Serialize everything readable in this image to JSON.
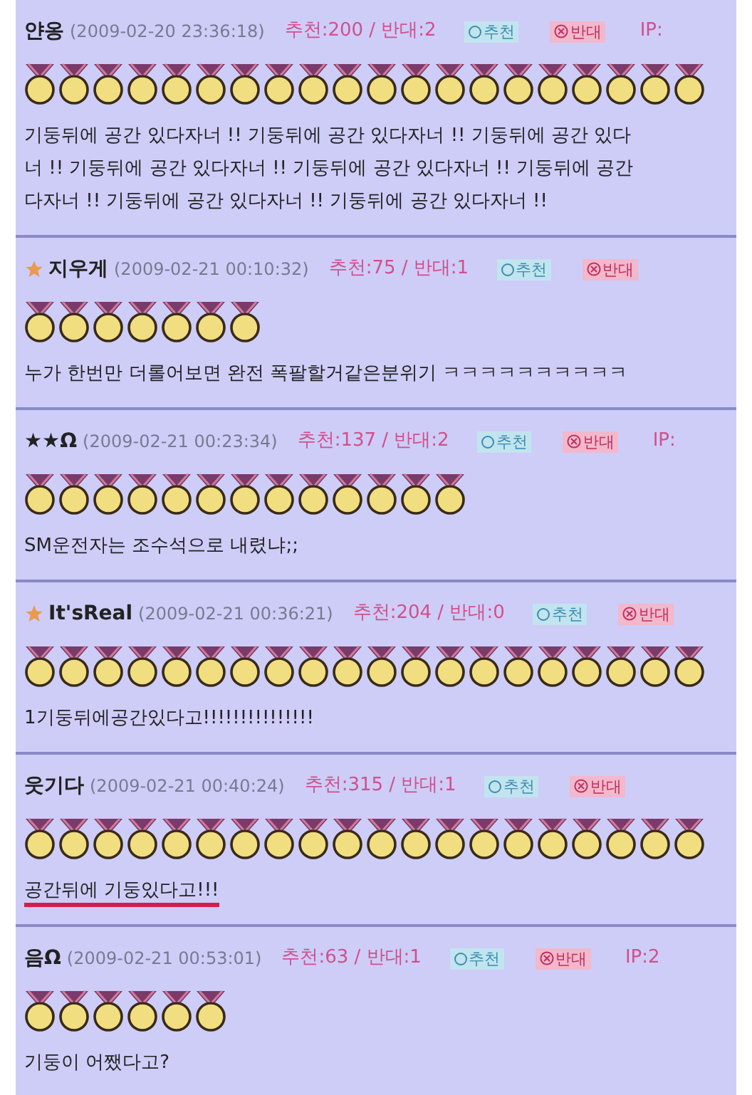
{
  "comments": [
    {
      "name": "얀옹",
      "starred": false,
      "date": "(2009-02-20 23:36:18)",
      "votes": "추천:200 / 반대:2",
      "like": "추천",
      "dislike": "반대",
      "ip": "IP:",
      "medals": [
        {
          "kind": "medal"
        },
        {
          "kind": "medal"
        },
        {
          "kind": "medal"
        },
        {
          "kind": "medal"
        },
        {
          "kind": "medal"
        },
        {
          "kind": "medal"
        },
        {
          "kind": "medal"
        },
        {
          "kind": "medal"
        },
        {
          "kind": "medal"
        },
        {
          "kind": "medal"
        },
        {
          "kind": "medal"
        },
        {
          "kind": "medal"
        },
        {
          "kind": "medal"
        },
        {
          "kind": "medal"
        },
        {
          "kind": "medal"
        },
        {
          "kind": "medal"
        },
        {
          "kind": "medal"
        },
        {
          "kind": "medal"
        },
        {
          "kind": "medal"
        },
        {
          "kind": "medal"
        }
      ],
      "lines": [
        "기둥뒤에 공간 있다자너 !! 기둥뒤에 공간 있다자너 !! 기둥뒤에 공간 있다",
        "너 !! 기둥뒤에 공간 있다자너 !! 기둥뒤에 공간 있다자너 !! 기둥뒤에 공간",
        "다자너 !! 기둥뒤에 공간 있다자너 !! 기둥뒤에 공간 있다자너 !!"
      ],
      "underlined": false
    },
    {
      "name": "지우게",
      "starred": true,
      "date": "(2009-02-21 00:10:32)",
      "votes": "추천:75 / 반대:1",
      "like": "추천",
      "dislike": "반대",
      "medals": [
        {
          "kind": "medal"
        },
        {
          "kind": "medal"
        },
        {
          "kind": "medal"
        },
        {
          "kind": "medal"
        },
        {
          "kind": "medal"
        },
        {
          "kind": "medal"
        },
        {
          "kind": "medal"
        }
      ],
      "lines": [
        "누가 한번만 더롤어보면 완전 폭팔할거같은분위기 ㅋㅋㅋㅋㅋㅋㅋㅋㅋㅋ"
      ],
      "underlined": false
    },
    {
      "name": "★★Ω",
      "starred": false,
      "date": "(2009-02-21 00:23:34)",
      "votes": "추천:137 / 반대:2",
      "like": "추천",
      "dislike": "반대",
      "ip": "IP:",
      "medals": [
        {
          "kind": "medal"
        },
        {
          "kind": "medal"
        },
        {
          "kind": "medal"
        },
        {
          "kind": "medal"
        },
        {
          "kind": "medal"
        },
        {
          "kind": "medal"
        },
        {
          "kind": "medal"
        },
        {
          "kind": "medal"
        },
        {
          "kind": "medal"
        },
        {
          "kind": "medal"
        },
        {
          "kind": "medal"
        },
        {
          "kind": "medal"
        },
        {
          "kind": "medal"
        }
      ],
      "lines": [
        "SM운전자는 조수석으로 내렸냐;;"
      ],
      "underlined": false
    },
    {
      "name": "It'sReal",
      "starred": true,
      "date": "(2009-02-21 00:36:21)",
      "votes": "추천:204 / 반대:0",
      "like": "추천",
      "dislike": "반대",
      "medals": [
        {
          "kind": "medal"
        },
        {
          "kind": "medal"
        },
        {
          "kind": "medal"
        },
        {
          "kind": "medal"
        },
        {
          "kind": "medal"
        },
        {
          "kind": "medal"
        },
        {
          "kind": "medal"
        },
        {
          "kind": "medal"
        },
        {
          "kind": "medal"
        },
        {
          "kind": "medal"
        },
        {
          "kind": "medal"
        },
        {
          "kind": "medal"
        },
        {
          "kind": "medal"
        },
        {
          "kind": "medal"
        },
        {
          "kind": "medal"
        },
        {
          "kind": "medal"
        },
        {
          "kind": "medal"
        },
        {
          "kind": "medal"
        },
        {
          "kind": "medal"
        },
        {
          "kind": "medal"
        }
      ],
      "lines": [
        "1기둥뒤에공간있다고!!!!!!!!!!!!!!!"
      ],
      "underlined": false
    },
    {
      "name": "웃기다",
      "starred": false,
      "date": "(2009-02-21 00:40:24)",
      "votes": "추천:315 / 반대:1",
      "like": "추천",
      "dislike": "반대",
      "medals": [
        {
          "kind": "medal"
        },
        {
          "kind": "medal"
        },
        {
          "kind": "medal"
        },
        {
          "kind": "medal"
        },
        {
          "kind": "medal"
        },
        {
          "kind": "medal"
        },
        {
          "kind": "medal"
        },
        {
          "kind": "medal"
        },
        {
          "kind": "medal"
        },
        {
          "kind": "medal"
        },
        {
          "kind": "medal"
        },
        {
          "kind": "medal"
        },
        {
          "kind": "medal"
        },
        {
          "kind": "medal"
        },
        {
          "kind": "medal"
        },
        {
          "kind": "medal"
        },
        {
          "kind": "medal"
        },
        {
          "kind": "medal"
        },
        {
          "kind": "medal"
        },
        {
          "kind": "medal"
        }
      ],
      "lines": [
        "공간뒤에 기둥있다고!!!"
      ],
      "underlined": true
    },
    {
      "name": "음Ω",
      "starred": false,
      "date": "(2009-02-21 00:53:01)",
      "votes": "추천:63 / 반대:1",
      "like": "추천",
      "dislike": "반대",
      "ip": "IP:2",
      "medals": [
        {
          "kind": "medal"
        },
        {
          "kind": "medal"
        },
        {
          "kind": "medal"
        },
        {
          "kind": "medal"
        },
        {
          "kind": "medal"
        },
        {
          "kind": "medal"
        }
      ],
      "lines": [
        "기둥이 어쨌다고?"
      ],
      "underlined": false
    }
  ]
}
